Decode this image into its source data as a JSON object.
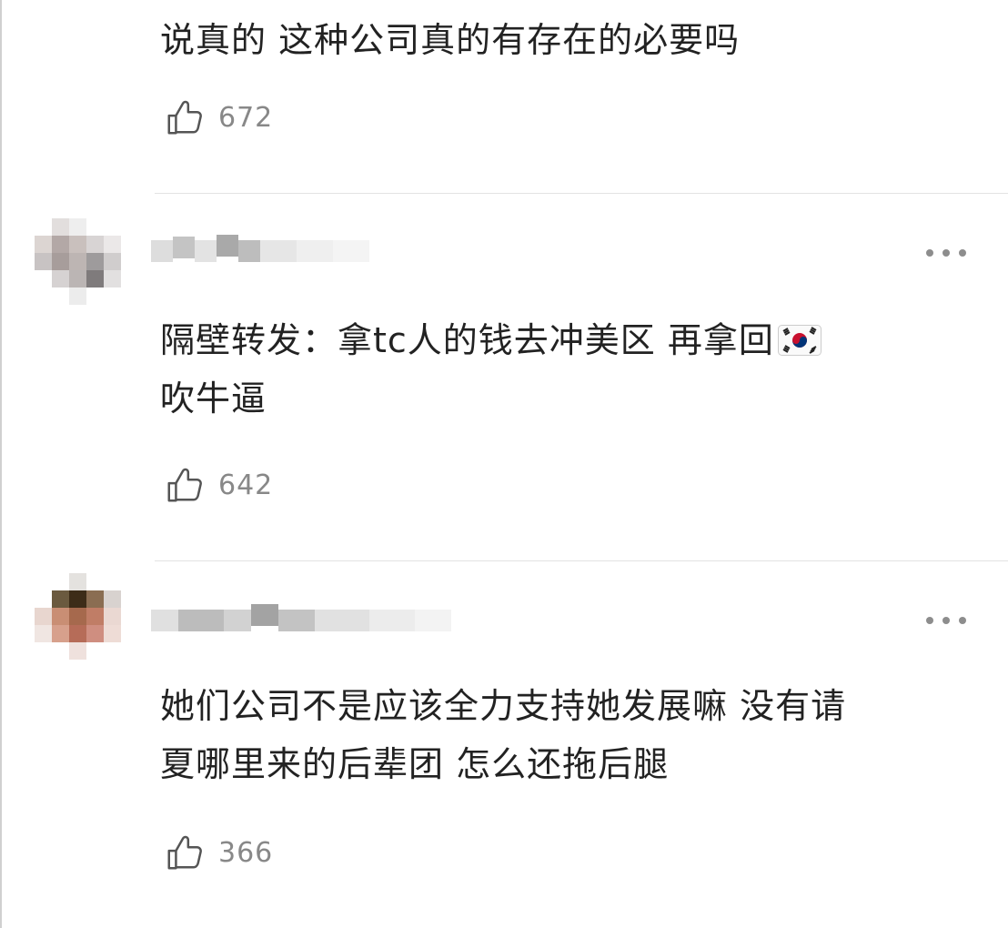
{
  "comments": [
    {
      "text": "说真的 这种公司真的有存在的必要吗",
      "likes": "672"
    },
    {
      "text": "隔壁转发：拿tc人的钱去冲美区 再拿回",
      "text_line2": "吹牛逼",
      "flag_icon": "south-korea-flag-emoji",
      "likes": "642"
    },
    {
      "text_line1": "她们公司不是应该全力支持她发展嘛 没有请",
      "text_line2": "夏哪里来的后辈团 怎么还拖后腿",
      "likes": "366"
    }
  ],
  "icons": {
    "like": "thumbs-up-icon",
    "more": "more-options-icon"
  },
  "colors": {
    "text": "#222222",
    "muted": "#888888",
    "divider": "#e3e3e3"
  }
}
